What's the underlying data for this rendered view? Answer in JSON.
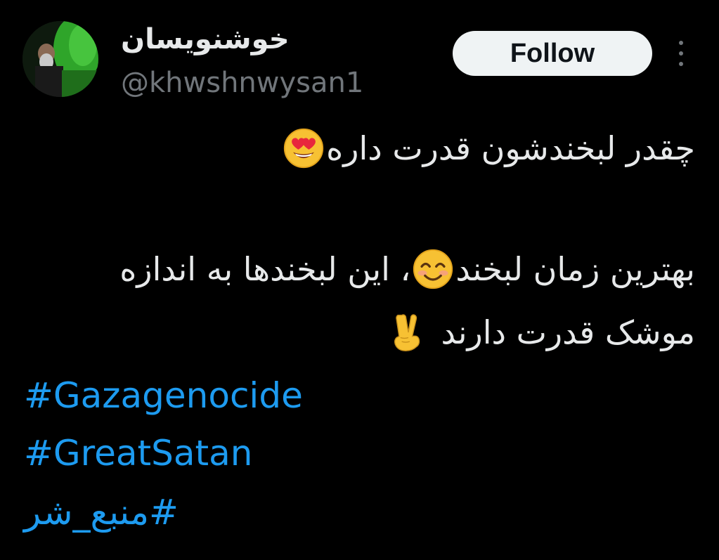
{
  "author": {
    "display_name": "خوشنویسان",
    "handle": "@khwshnwysan1",
    "avatar": "profile-photo"
  },
  "actions": {
    "follow_label": "Follow",
    "more_icon": "more-vertical-icon"
  },
  "tweet": {
    "line1_text": "چقدر لبخندشون قدرت داره",
    "line1_emoji": "smiling-face-with-heart-eyes",
    "line2_text_a": "بهترین زمان لبخند",
    "line2_emoji": "smiling-face-with-smiling-eyes",
    "line2_text_b": "، این لبخندها به اندازه",
    "line3_text": "موشک قدرت دارند",
    "line3_emoji": "victory-hand",
    "hashtags": [
      "#Gazagenocide",
      "#GreatSatan",
      "#منبع_شر"
    ]
  },
  "colors": {
    "background": "#000000",
    "text": "#e7e9ea",
    "secondary_text": "#71767b",
    "link": "#1d9bf0",
    "button_bg": "#eff3f4",
    "button_text": "#0f1419"
  }
}
